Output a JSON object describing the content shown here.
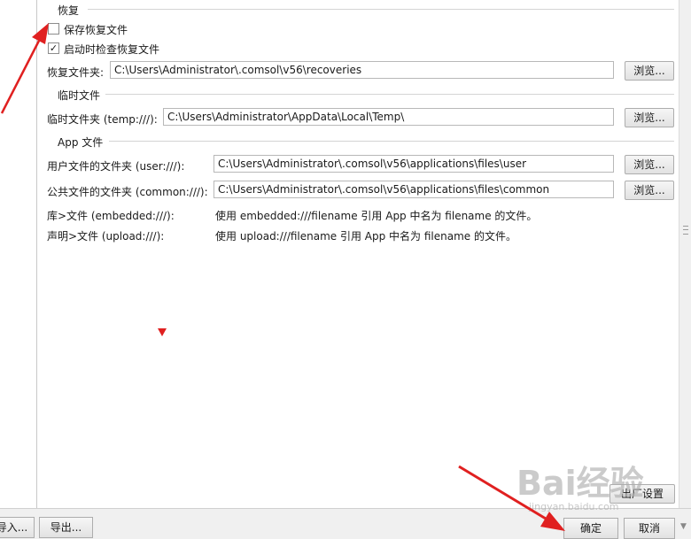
{
  "recovery": {
    "section_title": "恢复",
    "save_recovery_label": "保存恢复文件",
    "save_recovery_checked": false,
    "check_on_start_label": "启动时检查恢复文件",
    "check_on_start_checked": true,
    "folder_label": "恢复文件夹:",
    "folder_value": "C:\\Users\\Administrator\\.comsol\\v56\\recoveries",
    "browse_label": "浏览..."
  },
  "temp": {
    "section_title": "临时文件",
    "folder_label": "临时文件夹 (temp:///):",
    "folder_value": "C:\\Users\\Administrator\\AppData\\Local\\Temp\\",
    "browse_label": "浏览..."
  },
  "app": {
    "section_title": "App 文件",
    "user_label": "用户文件的文件夹 (user:///):",
    "user_value": "C:\\Users\\Administrator\\.comsol\\v56\\applications\\files\\user",
    "user_browse_label": "浏览...",
    "common_label": "公共文件的文件夹 (common:///):",
    "common_value": "C:\\Users\\Administrator\\.comsol\\v56\\applications\\files\\common",
    "common_browse_label": "浏览...",
    "embedded_label": "库>文件 (embedded:///):",
    "embedded_desc": "使用 embedded:///filename 引用 App 中名为 filename 的文件。",
    "upload_label": "声明>文件 (upload:///):",
    "upload_desc": "使用 upload:///filename 引用 App 中名为 filename 的文件。"
  },
  "footer": {
    "factory_settings_label": "出厂设置",
    "import_label": "导入...",
    "export_label": "导出...",
    "ok_label": "确定",
    "cancel_label": "取消"
  },
  "watermark": {
    "brand": "Bai经验",
    "url": "jingyan.baidu.com"
  },
  "colors": {
    "annotation_arrow": "#e02020"
  }
}
